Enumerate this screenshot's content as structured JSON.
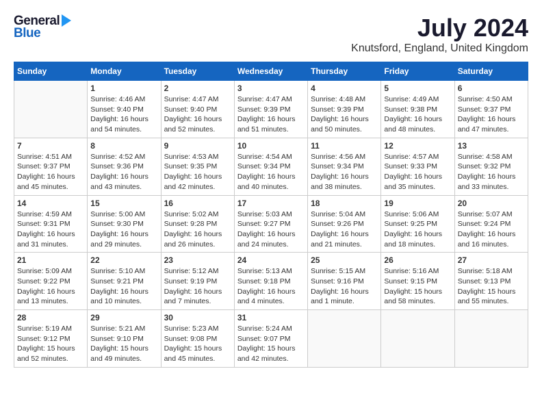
{
  "header": {
    "logo_general": "General",
    "logo_blue": "Blue",
    "title": "July 2024",
    "location": "Knutsford, England, United Kingdom"
  },
  "calendar": {
    "days_of_week": [
      "Sunday",
      "Monday",
      "Tuesday",
      "Wednesday",
      "Thursday",
      "Friday",
      "Saturday"
    ],
    "weeks": [
      [
        {
          "day": "",
          "content": ""
        },
        {
          "day": "1",
          "content": "Sunrise: 4:46 AM\nSunset: 9:40 PM\nDaylight: 16 hours\nand 54 minutes."
        },
        {
          "day": "2",
          "content": "Sunrise: 4:47 AM\nSunset: 9:40 PM\nDaylight: 16 hours\nand 52 minutes."
        },
        {
          "day": "3",
          "content": "Sunrise: 4:47 AM\nSunset: 9:39 PM\nDaylight: 16 hours\nand 51 minutes."
        },
        {
          "day": "4",
          "content": "Sunrise: 4:48 AM\nSunset: 9:39 PM\nDaylight: 16 hours\nand 50 minutes."
        },
        {
          "day": "5",
          "content": "Sunrise: 4:49 AM\nSunset: 9:38 PM\nDaylight: 16 hours\nand 48 minutes."
        },
        {
          "day": "6",
          "content": "Sunrise: 4:50 AM\nSunset: 9:37 PM\nDaylight: 16 hours\nand 47 minutes."
        }
      ],
      [
        {
          "day": "7",
          "content": "Sunrise: 4:51 AM\nSunset: 9:37 PM\nDaylight: 16 hours\nand 45 minutes."
        },
        {
          "day": "8",
          "content": "Sunrise: 4:52 AM\nSunset: 9:36 PM\nDaylight: 16 hours\nand 43 minutes."
        },
        {
          "day": "9",
          "content": "Sunrise: 4:53 AM\nSunset: 9:35 PM\nDaylight: 16 hours\nand 42 minutes."
        },
        {
          "day": "10",
          "content": "Sunrise: 4:54 AM\nSunset: 9:34 PM\nDaylight: 16 hours\nand 40 minutes."
        },
        {
          "day": "11",
          "content": "Sunrise: 4:56 AM\nSunset: 9:34 PM\nDaylight: 16 hours\nand 38 minutes."
        },
        {
          "day": "12",
          "content": "Sunrise: 4:57 AM\nSunset: 9:33 PM\nDaylight: 16 hours\nand 35 minutes."
        },
        {
          "day": "13",
          "content": "Sunrise: 4:58 AM\nSunset: 9:32 PM\nDaylight: 16 hours\nand 33 minutes."
        }
      ],
      [
        {
          "day": "14",
          "content": "Sunrise: 4:59 AM\nSunset: 9:31 PM\nDaylight: 16 hours\nand 31 minutes."
        },
        {
          "day": "15",
          "content": "Sunrise: 5:00 AM\nSunset: 9:30 PM\nDaylight: 16 hours\nand 29 minutes."
        },
        {
          "day": "16",
          "content": "Sunrise: 5:02 AM\nSunset: 9:28 PM\nDaylight: 16 hours\nand 26 minutes."
        },
        {
          "day": "17",
          "content": "Sunrise: 5:03 AM\nSunset: 9:27 PM\nDaylight: 16 hours\nand 24 minutes."
        },
        {
          "day": "18",
          "content": "Sunrise: 5:04 AM\nSunset: 9:26 PM\nDaylight: 16 hours\nand 21 minutes."
        },
        {
          "day": "19",
          "content": "Sunrise: 5:06 AM\nSunset: 9:25 PM\nDaylight: 16 hours\nand 18 minutes."
        },
        {
          "day": "20",
          "content": "Sunrise: 5:07 AM\nSunset: 9:24 PM\nDaylight: 16 hours\nand 16 minutes."
        }
      ],
      [
        {
          "day": "21",
          "content": "Sunrise: 5:09 AM\nSunset: 9:22 PM\nDaylight: 16 hours\nand 13 minutes."
        },
        {
          "day": "22",
          "content": "Sunrise: 5:10 AM\nSunset: 9:21 PM\nDaylight: 16 hours\nand 10 minutes."
        },
        {
          "day": "23",
          "content": "Sunrise: 5:12 AM\nSunset: 9:19 PM\nDaylight: 16 hours\nand 7 minutes."
        },
        {
          "day": "24",
          "content": "Sunrise: 5:13 AM\nSunset: 9:18 PM\nDaylight: 16 hours\nand 4 minutes."
        },
        {
          "day": "25",
          "content": "Sunrise: 5:15 AM\nSunset: 9:16 PM\nDaylight: 16 hours\nand 1 minute."
        },
        {
          "day": "26",
          "content": "Sunrise: 5:16 AM\nSunset: 9:15 PM\nDaylight: 15 hours\nand 58 minutes."
        },
        {
          "day": "27",
          "content": "Sunrise: 5:18 AM\nSunset: 9:13 PM\nDaylight: 15 hours\nand 55 minutes."
        }
      ],
      [
        {
          "day": "28",
          "content": "Sunrise: 5:19 AM\nSunset: 9:12 PM\nDaylight: 15 hours\nand 52 minutes."
        },
        {
          "day": "29",
          "content": "Sunrise: 5:21 AM\nSunset: 9:10 PM\nDaylight: 15 hours\nand 49 minutes."
        },
        {
          "day": "30",
          "content": "Sunrise: 5:23 AM\nSunset: 9:08 PM\nDaylight: 15 hours\nand 45 minutes."
        },
        {
          "day": "31",
          "content": "Sunrise: 5:24 AM\nSunset: 9:07 PM\nDaylight: 15 hours\nand 42 minutes."
        },
        {
          "day": "",
          "content": ""
        },
        {
          "day": "",
          "content": ""
        },
        {
          "day": "",
          "content": ""
        }
      ]
    ]
  }
}
